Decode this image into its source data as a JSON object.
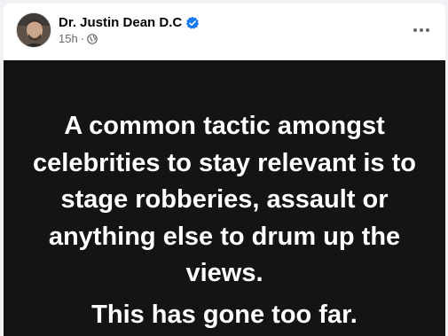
{
  "post": {
    "author_name": "Dr. Justin Dean D.C",
    "verified": true,
    "time_ago": "15h",
    "separator": "·",
    "audience_icon": "globe-icon",
    "more_icon": "more-horizontal-icon"
  },
  "image_text": {
    "paragraph_1": "A common tactic amongst celebrities to stay relevant is to stage robberies, assault or anything else to drum up the views.",
    "paragraph_2": "This has gone too far."
  },
  "colors": {
    "verified_badge": "#1877f2",
    "image_background": "#141414",
    "image_text": "#ffffff",
    "secondary_text": "#65676b"
  }
}
